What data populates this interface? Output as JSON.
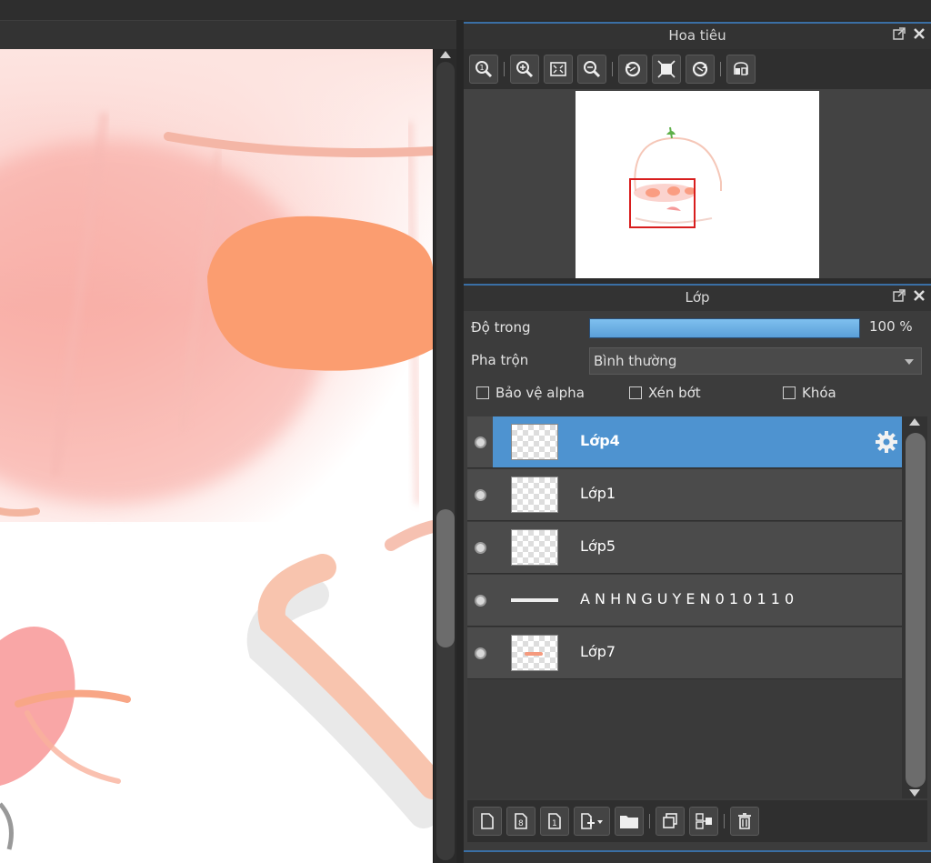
{
  "navigator": {
    "title": "Hoa tiêu",
    "tools": [
      "zoom-actual-icon",
      "zoom-in-icon",
      "fit-screen-icon",
      "zoom-out-icon",
      "rotate-left-icon",
      "fit-window-icon",
      "rotate-right-icon",
      "flip-icon"
    ]
  },
  "layers": {
    "title": "Lớp",
    "opacity_label": "Độ trong",
    "opacity_value": "100 %",
    "opacity_fraction": 1.0,
    "blend_label": "Pha trộn",
    "blend_value": "Bình thường",
    "protect_alpha": "Bảo vệ alpha",
    "clipping": "Xén bớt",
    "lock": "Khóa",
    "items": [
      {
        "name": "Lớp4",
        "selected": true
      },
      {
        "name": "Lớp1",
        "selected": false
      },
      {
        "name": "Lớp5",
        "selected": false
      },
      {
        "name": "A N H N G U Y E N 0 1 0 1 1 0",
        "selected": false
      },
      {
        "name": "Lớp7",
        "selected": false
      }
    ]
  },
  "colors": {
    "accent": "#4e93d0",
    "panel": "#3c3c3c",
    "canvas_pink": "#f7a7a0",
    "canvas_orange": "#fb9d70"
  }
}
